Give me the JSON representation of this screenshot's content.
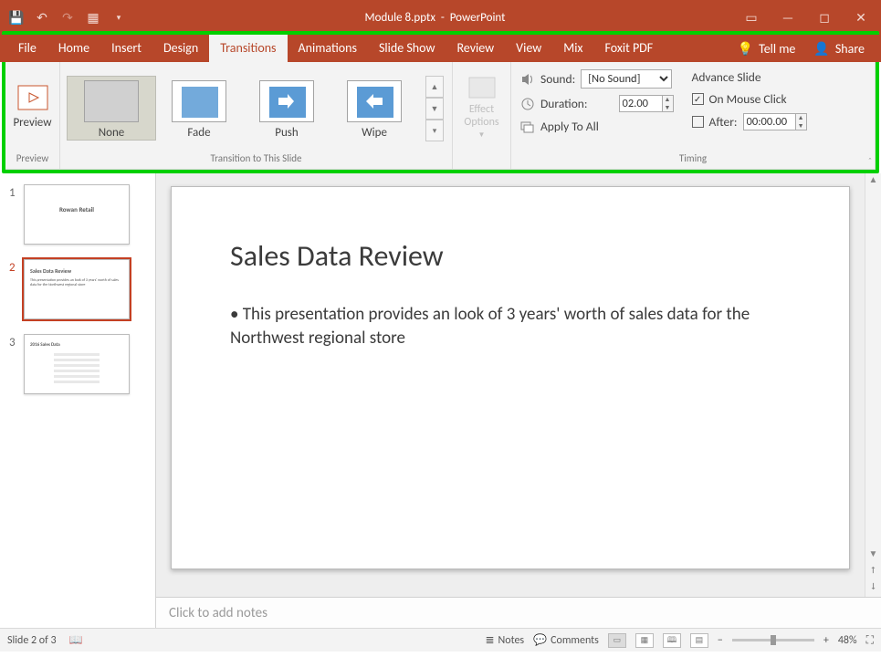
{
  "titlebar": {
    "doc_title": "Module 8.pptx  -  PowerPoint"
  },
  "menu": {
    "tabs": [
      "File",
      "Home",
      "Insert",
      "Design",
      "Transitions",
      "Animations",
      "Slide Show",
      "Review",
      "View",
      "Mix",
      "Foxit PDF"
    ],
    "active_index": 4,
    "tellme": "Tell me",
    "share": "Share"
  },
  "ribbon": {
    "preview_group_label": "Preview",
    "preview_button": "Preview",
    "transition_group_label": "Transition to This Slide",
    "transitions": [
      {
        "name": "None",
        "selected": true
      },
      {
        "name": "Fade",
        "selected": false
      },
      {
        "name": "Push",
        "selected": false
      },
      {
        "name": "Wipe",
        "selected": false
      }
    ],
    "effect_options": "Effect Options",
    "timing_group_label": "Timing",
    "sound_label": "Sound:",
    "sound_value": "[No Sound]",
    "duration_label": "Duration:",
    "duration_value": "02.00",
    "apply_all": "Apply To All",
    "advance_header": "Advance Slide",
    "on_click_label": "On Mouse Click",
    "on_click_checked": true,
    "after_label": "After:",
    "after_checked": false,
    "after_value": "00:00.00"
  },
  "thumbnails": [
    {
      "n": "1",
      "title": "Rowan Retail",
      "sub": "",
      "selected": false
    },
    {
      "n": "2",
      "title": "Sales Data Review",
      "sub": "This presentation provides an look of 3 years' worth of sales data for the Northwest regional store",
      "selected": true
    },
    {
      "n": "3",
      "title": "2016 Sales Data",
      "sub": "",
      "selected": false
    }
  ],
  "slide": {
    "title": "Sales Data Review",
    "bullet": "This presentation provides an look of 3 years' worth of sales data for the Northwest regional store"
  },
  "notes_placeholder": "Click to add notes",
  "status": {
    "slide_of": "Slide 2 of 3",
    "notes": "Notes",
    "comments": "Comments",
    "zoom": "48%"
  }
}
